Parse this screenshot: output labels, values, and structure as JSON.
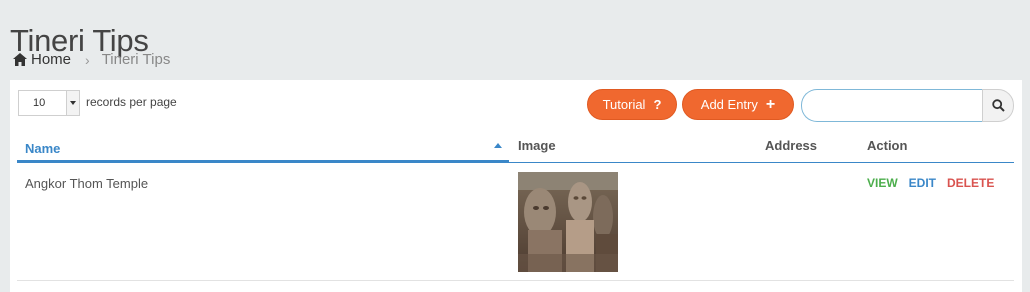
{
  "page": {
    "title": "Tineri Tips"
  },
  "breadcrumb": {
    "home_label": "Home",
    "separator": "›",
    "current": "Tineri Tips"
  },
  "toolbar": {
    "length_value": "10",
    "length_label": "records per page",
    "tutorial_label": "Tutorial",
    "tutorial_glyph": "?",
    "add_label": "Add Entry",
    "add_glyph": "+",
    "search_value": "",
    "search_placeholder": ""
  },
  "table": {
    "columns": [
      "Name",
      "Image",
      "Address",
      "Action"
    ],
    "sort": {
      "column": "Name",
      "direction": "ascending"
    },
    "rows": [
      {
        "name": "Angkor Thom Temple",
        "image": "stone-faces-thumbnail",
        "address": "",
        "actions": [
          "VIEW",
          "EDIT",
          "DELETE"
        ]
      }
    ]
  },
  "colors": {
    "accent_orange": "#f0682f",
    "link_blue": "#3a87c8",
    "view_green": "#4cae4c",
    "delete_red": "#d9534f",
    "page_bg": "#e8ebec"
  },
  "icons": {
    "home": "home-icon",
    "length_dropdown": "caret-down-icon",
    "tutorial": "question-icon",
    "add": "plus-icon",
    "search": "search-icon",
    "sort": "sort-asc-icon"
  }
}
